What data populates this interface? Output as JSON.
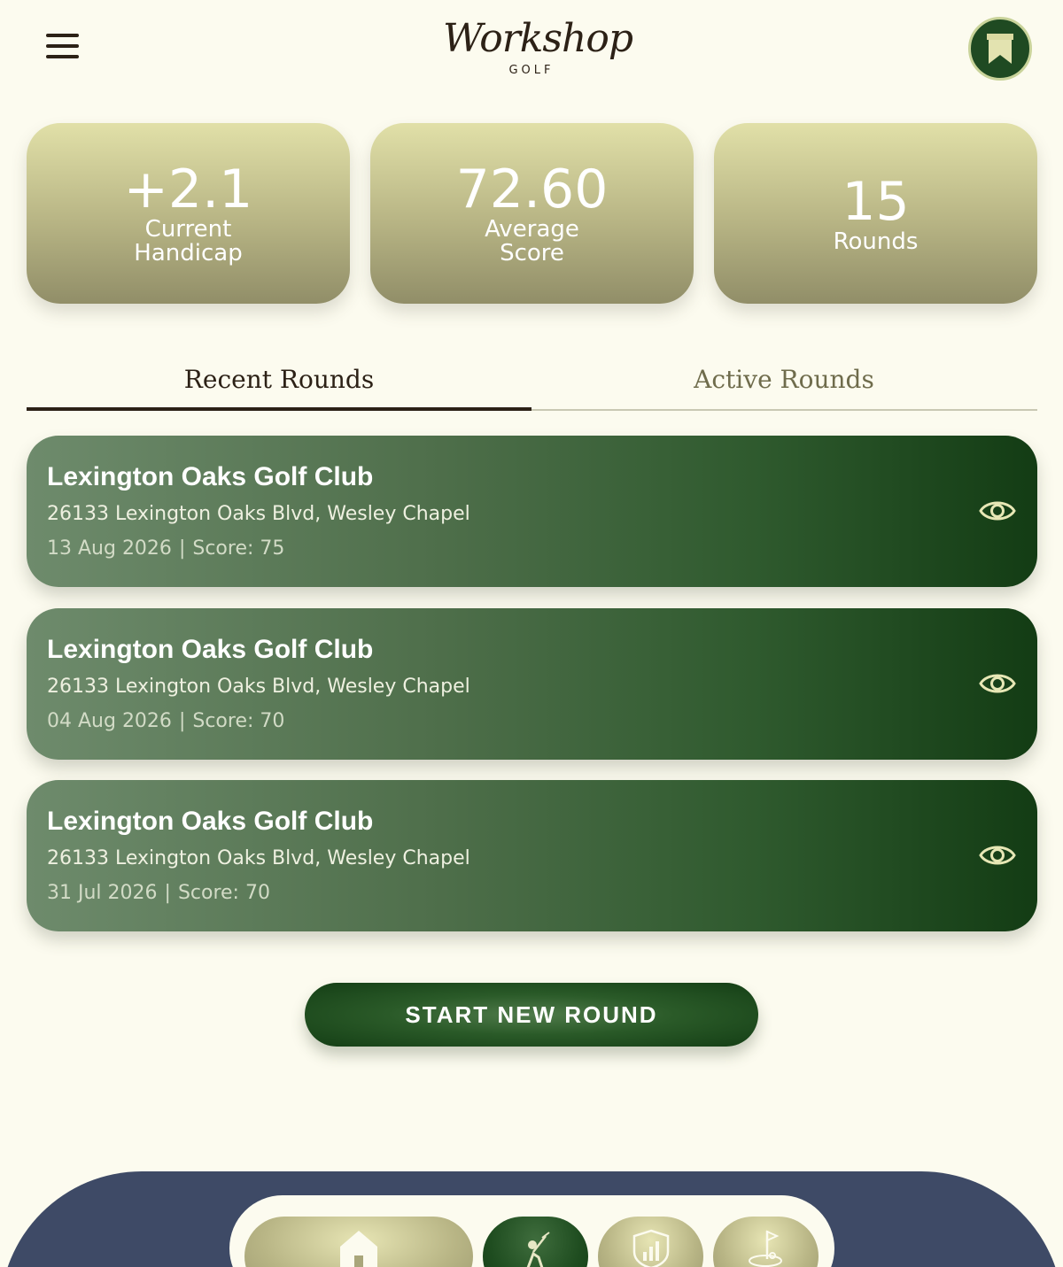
{
  "header": {
    "brand_script": "Workshop",
    "brand_sub": "GOLF"
  },
  "stats": [
    {
      "value": "+2.1",
      "label_line1": "Current",
      "label_line2": "Handicap"
    },
    {
      "value": "72.60",
      "label_line1": "Average",
      "label_line2": "Score"
    },
    {
      "value": "15",
      "label_line1": "Rounds",
      "label_line2": ""
    }
  ],
  "tabs": {
    "recent": "Recent Rounds",
    "active": "Active Rounds",
    "selected": "recent"
  },
  "rounds": [
    {
      "course": "Lexington Oaks Golf Club",
      "address": "26133 Lexington Oaks Blvd, Wesley Chapel",
      "date": "13 Aug 2026",
      "score": "Score: 75"
    },
    {
      "course": "Lexington Oaks Golf Club",
      "address": "26133 Lexington Oaks Blvd, Wesley Chapel",
      "date": "04 Aug 2026",
      "score": "Score: 70"
    },
    {
      "course": "Lexington Oaks Golf Club",
      "address": "26133 Lexington Oaks Blvd, Wesley Chapel",
      "date": "31 Jul 2026",
      "score": "Score: 70"
    }
  ],
  "actions": {
    "start_round": "START NEW ROUND"
  },
  "nav": {
    "items": [
      {
        "icon": "home-icon"
      },
      {
        "icon": "golfer-icon"
      },
      {
        "icon": "stats-shield-icon"
      },
      {
        "icon": "golf-flag-icon"
      }
    ],
    "active_index": 1
  },
  "colors": {
    "background": "#fcfbef",
    "dark_green": "#133c14",
    "card_gold": "#b7b484",
    "nav_bar": "#3e4a66",
    "text_dark": "#2c2116"
  }
}
